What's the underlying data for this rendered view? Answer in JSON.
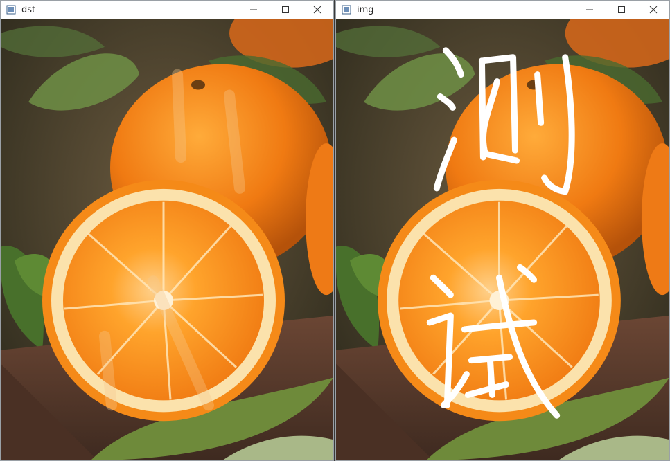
{
  "windows": [
    {
      "title": "dst",
      "controls": {
        "minimize": "minimize-icon",
        "maximize": "maximize-icon",
        "close": "close-icon"
      }
    },
    {
      "title": "img",
      "controls": {
        "minimize": "minimize-icon",
        "maximize": "maximize-icon",
        "close": "close-icon"
      }
    }
  ],
  "colors": {
    "orange": "#f07a12",
    "orange_dark": "#c65a06",
    "pith": "#fbe7b5",
    "leaf": "#4c6b2a",
    "wood": "#5a3a2a",
    "stroke_white": "#ffffff"
  }
}
